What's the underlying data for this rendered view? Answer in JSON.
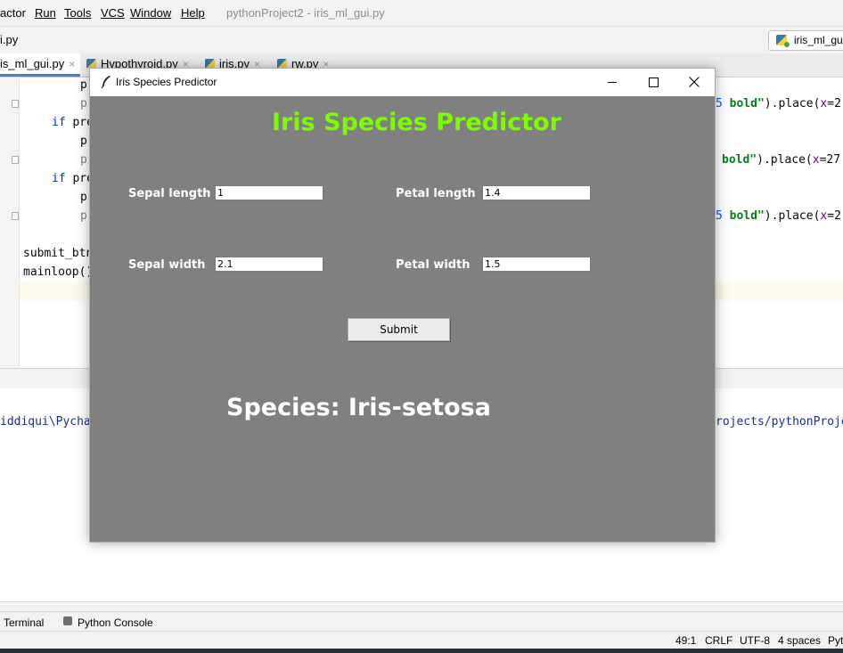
{
  "ide": {
    "menu": [
      "actor",
      "Run",
      "Tools",
      "VCS",
      "Window",
      "Help"
    ],
    "title": "pythonProject2 - iris_ml_gui.py",
    "nav_file": "i.py",
    "run_config": "iris_ml_gui",
    "tabs": [
      {
        "label": "is_ml_gui.py"
      },
      {
        "label": "Hypothyroid.py"
      },
      {
        "label": "iris.py"
      },
      {
        "label": "rw.py"
      }
    ],
    "code": {
      "line1": "pr",
      "line2": "pr",
      "line3_kw": "if",
      "line3_rest": " pre",
      "line4": "pr",
      "line5": "pr",
      "line6_kw": "if",
      "line6_rest": " pre",
      "line7": "pr",
      "line8": "pr",
      "submit_line": "submit_btn",
      "mainloop_line": "mainloop()",
      "right1_num": "5",
      "right1_str": " bold\"",
      "right1_call": ").place(",
      "right1_prm": "x",
      "right1_tail": "=2",
      "right2_str": "bold\"",
      "right2_call": ").place(",
      "right2_prm": "x",
      "right2_tail": "=27",
      "right3_num": "5",
      "right3_str": " bold\"",
      "right3_call": ").place(",
      "right3_prm": "x",
      "right3_tail": "=2"
    },
    "run_output_left": "iddiqui\\Pycha",
    "run_output_right": "rojects/pythonProje",
    "bottom_tools": [
      "Terminal",
      "Python Console"
    ],
    "status": {
      "position": "49:1",
      "line_sep": "CRLF",
      "encoding": "UTF-8",
      "indent": "4 spaces",
      "interpreter": "Pyt"
    }
  },
  "tk_window": {
    "title": "Iris Species Predictor",
    "heading": "Iris Species Predictor",
    "fields": {
      "sepal_length": {
        "label": "Sepal length",
        "value": "1"
      },
      "petal_length": {
        "label": "Petal length",
        "value": "1.4"
      },
      "sepal_width": {
        "label": "Sepal width",
        "value": "2.1"
      },
      "petal_width": {
        "label": "Petal width",
        "value": "1.5"
      }
    },
    "submit_label": "Submit",
    "result": "Species: Iris-setosa",
    "colors": {
      "background": "#808080",
      "heading": "#7CFC00",
      "label": "#ffffff"
    }
  }
}
